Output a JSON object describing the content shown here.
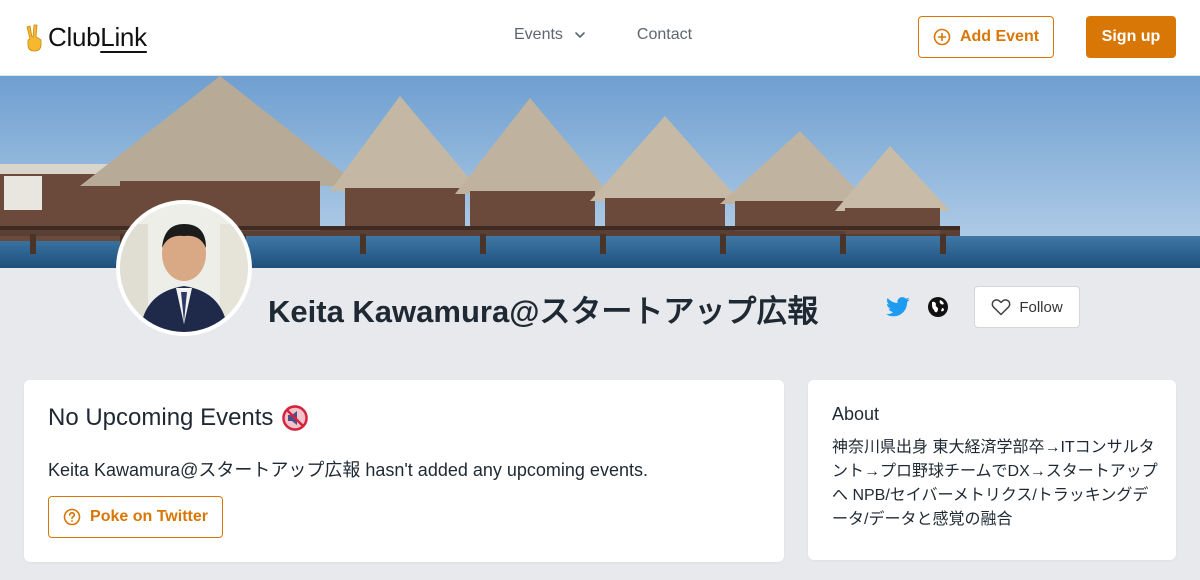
{
  "header": {
    "logo_prefix": "Club",
    "logo_suffix": "Link",
    "nav": {
      "events_label": "Events",
      "contact_label": "Contact"
    },
    "add_event_label": "Add Event",
    "sign_up_label": "Sign up"
  },
  "profile": {
    "name": "Keita Kawamura@スタートアップ広報",
    "follow_label": "Follow"
  },
  "events_card": {
    "title": "No Upcoming Events",
    "description": "Keita Kawamura@スタートアップ広報 hasn't added any upcoming events.",
    "poke_label": "Poke on Twitter"
  },
  "about_card": {
    "title": "About",
    "text": "神奈川県出身 東大経済学部卒→ITコンサルタント→プロ野球チームでDX→スタートアップへ NPB/セイバーメトリクス/トラッキングデータ/データと感覚の融合"
  },
  "colors": {
    "accent": "#d97706",
    "background": "#e7e9ed",
    "twitter": "#1d9bf0"
  },
  "icons": {
    "logo": "victory-hand-icon",
    "events_dropdown": "chevron-down-icon",
    "add_event": "plus-circle-icon",
    "twitter": "twitter-icon",
    "website": "globe-icon",
    "follow": "heart-icon",
    "no_events": "muted-speaker-icon",
    "poke": "question-circle-icon"
  }
}
